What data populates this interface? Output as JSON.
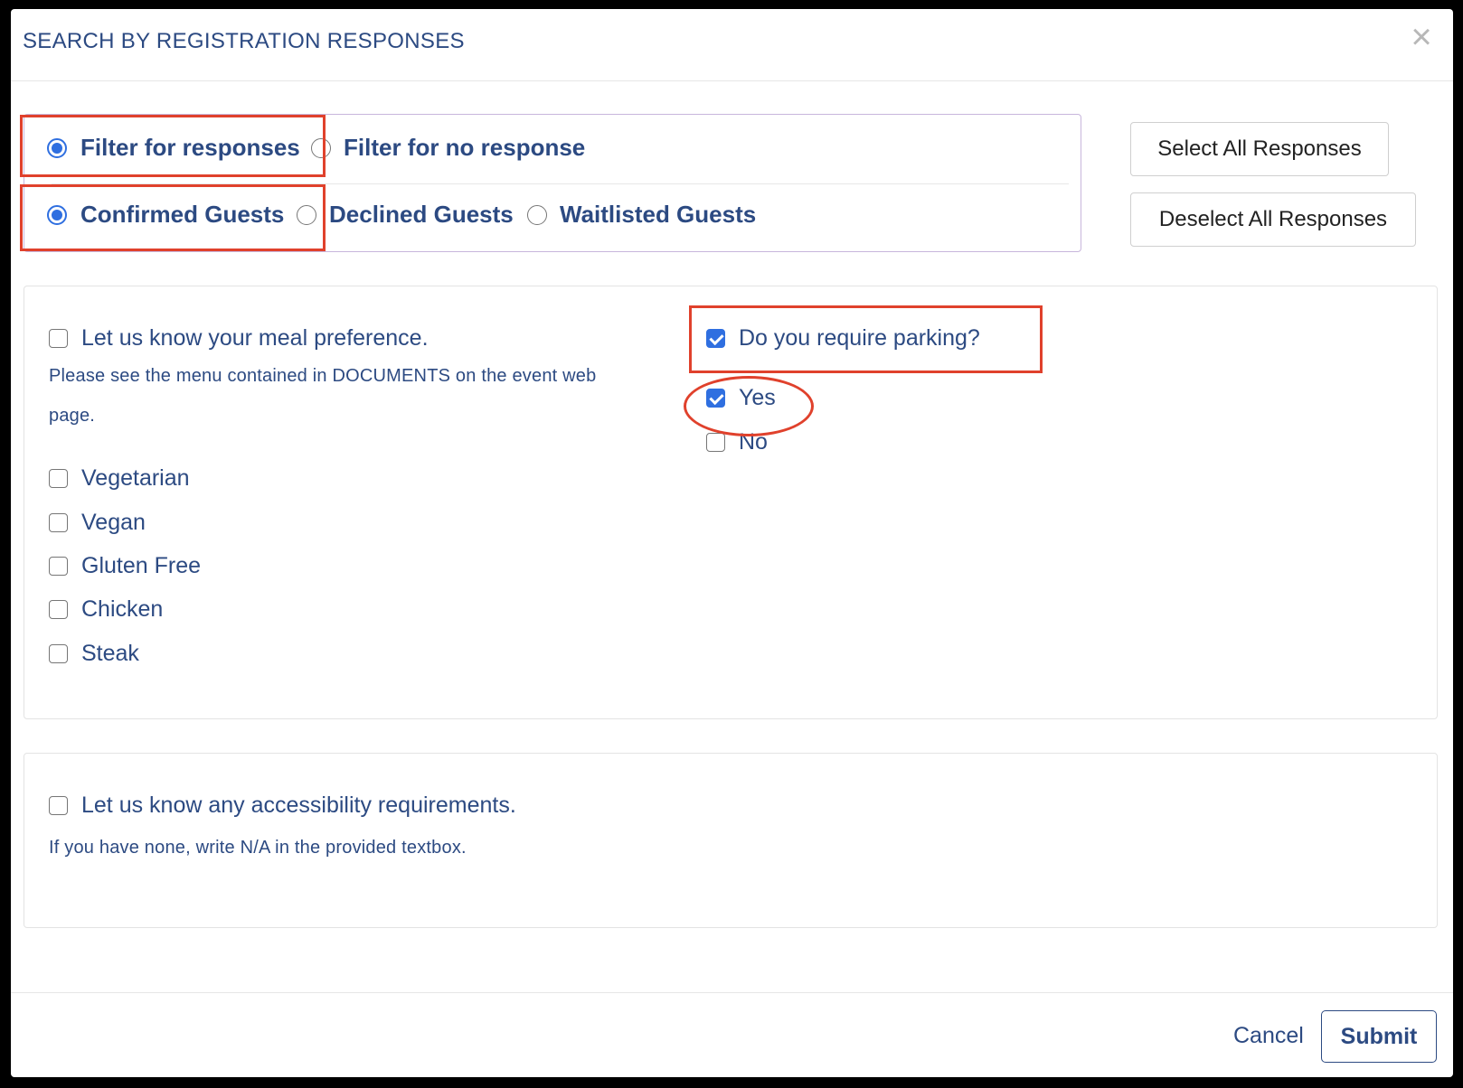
{
  "modal": {
    "title": "SEARCH BY REGISTRATION RESPONSES",
    "close_glyph": "×"
  },
  "filters": {
    "response_options": [
      {
        "label": "Filter for responses",
        "selected": true
      },
      {
        "label": "Filter for no response",
        "selected": false
      }
    ],
    "guest_options": [
      {
        "label": "Confirmed Guests",
        "selected": true
      },
      {
        "label": "Declined Guests",
        "selected": false
      },
      {
        "label": "Waitlisted Guests",
        "selected": false
      }
    ]
  },
  "buttons": {
    "select_all": "Select All Responses",
    "deselect_all": "Deselect All Responses"
  },
  "questions": {
    "meal": {
      "label": "Let us know your meal preference.",
      "help_line1": "Please see the menu contained in DOCUMENTS on the event web",
      "help_line2": "page.",
      "checked": false,
      "options": [
        {
          "label": "Vegetarian",
          "checked": false
        },
        {
          "label": "Vegan",
          "checked": false
        },
        {
          "label": "Gluten Free",
          "checked": false
        },
        {
          "label": "Chicken",
          "checked": false
        },
        {
          "label": "Steak",
          "checked": false
        }
      ]
    },
    "parking": {
      "label": "Do you require parking?",
      "checked": true,
      "options": [
        {
          "label": "Yes",
          "checked": true
        },
        {
          "label": "No",
          "checked": false
        }
      ]
    },
    "accessibility": {
      "label": "Let us know any accessibility requirements.",
      "help": "If you have none, write N/A in the provided textbox.",
      "checked": false
    }
  },
  "footer": {
    "cancel": "Cancel",
    "submit": "Submit"
  },
  "colors": {
    "accent": "#2f6fe0",
    "text": "#2c4a82",
    "annotation": "#e0412c"
  }
}
